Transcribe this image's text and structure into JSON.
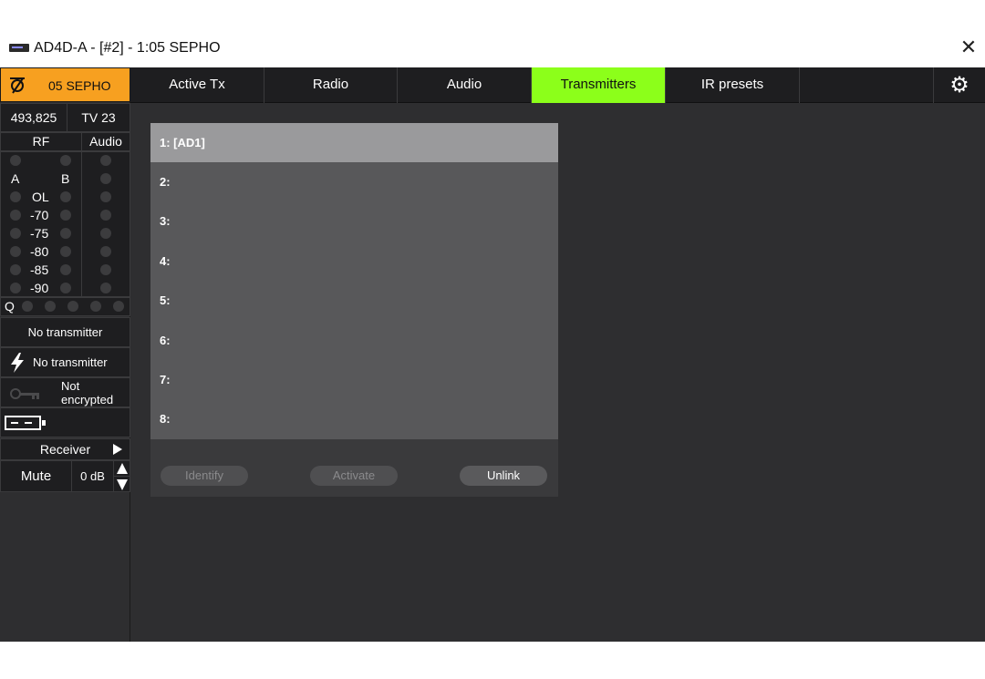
{
  "window": {
    "title": "AD4D-A - [#2] - 1:05 SEPHO",
    "close_symbol": "✕"
  },
  "sidebar": {
    "channel_name": "05 SEPHO",
    "frequency": "493,825",
    "tv_channel": "TV 23",
    "rf_header": "RF",
    "audio_header": "Audio",
    "antenna_a": "A",
    "antenna_b": "B",
    "rf_scale": [
      "OL",
      "-70",
      "-75",
      "-80",
      "-85",
      "-90"
    ],
    "quality_label": "Q",
    "transmitter_status": "No transmitter",
    "power_status": "No transmitter",
    "encryption_status_line1": "Not",
    "encryption_status_line2": "encrypted",
    "receiver_label": "Receiver",
    "mute_label": "Mute",
    "gain_value": "0 dB"
  },
  "tabs": [
    {
      "label": "Active Tx",
      "active": false
    },
    {
      "label": "Radio",
      "active": false
    },
    {
      "label": "Audio",
      "active": false
    },
    {
      "label": "Transmitters",
      "active": true
    },
    {
      "label": "IR presets",
      "active": false
    }
  ],
  "transmitters": [
    {
      "label": "1: [AD1]",
      "selected": true
    },
    {
      "label": "2:",
      "selected": false
    },
    {
      "label": "3:",
      "selected": false
    },
    {
      "label": "4:",
      "selected": false
    },
    {
      "label": "5:",
      "selected": false
    },
    {
      "label": "6:",
      "selected": false
    },
    {
      "label": "7:",
      "selected": false
    },
    {
      "label": "8:",
      "selected": false
    }
  ],
  "actions": {
    "identify_label": "Identify",
    "activate_label": "Activate",
    "unlink_label": "Unlink"
  },
  "colors": {
    "accent_orange": "#f7a020",
    "active_tab_green": "#8cff1a",
    "background": "#2e2e30"
  }
}
